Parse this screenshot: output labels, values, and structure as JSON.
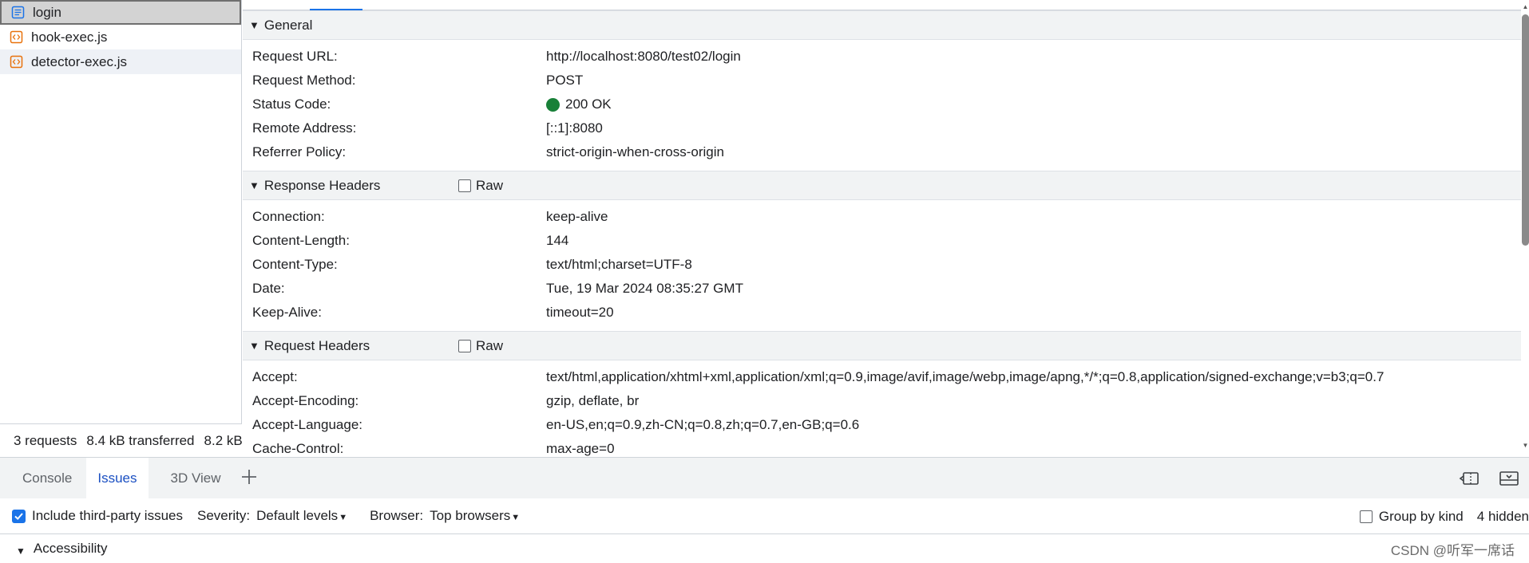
{
  "requests": [
    {
      "name": "login",
      "type": "document",
      "selected": true
    },
    {
      "name": "hook-exec.js",
      "type": "script",
      "selected": false
    },
    {
      "name": "detector-exec.js",
      "type": "script",
      "selected": false
    }
  ],
  "status_bar": {
    "requests": "3 requests",
    "transferred": "8.4 kB transferred",
    "resources": "8.2 kB"
  },
  "sections": {
    "general": {
      "title": "General",
      "rows": [
        {
          "key": "Request URL:",
          "value": "http://localhost:8080/test02/login"
        },
        {
          "key": "Request Method:",
          "value": "POST"
        },
        {
          "key": "Status Code:",
          "value": "200 OK"
        },
        {
          "key": "Remote Address:",
          "value": "[::1]:8080"
        },
        {
          "key": "Referrer Policy:",
          "value": "strict-origin-when-cross-origin"
        }
      ]
    },
    "response": {
      "title": "Response Headers",
      "raw_label": "Raw",
      "rows": [
        {
          "key": "Connection:",
          "value": "keep-alive"
        },
        {
          "key": "Content-Length:",
          "value": "144"
        },
        {
          "key": "Content-Type:",
          "value": "text/html;charset=UTF-8"
        },
        {
          "key": "Date:",
          "value": "Tue, 19 Mar 2024 08:35:27 GMT"
        },
        {
          "key": "Keep-Alive:",
          "value": "timeout=20"
        }
      ]
    },
    "request": {
      "title": "Request Headers",
      "raw_label": "Raw",
      "rows": [
        {
          "key": "Accept:",
          "value": "text/html,application/xhtml+xml,application/xml;q=0.9,image/avif,image/webp,image/apng,*/*;q=0.8,application/signed-exchange;v=b3;q=0.7"
        },
        {
          "key": "Accept-Encoding:",
          "value": "gzip, deflate, br"
        },
        {
          "key": "Accept-Language:",
          "value": "en-US,en;q=0.9,zh-CN;q=0.8,zh;q=0.7,en-GB;q=0.6"
        },
        {
          "key": "Cache-Control:",
          "value": "max-age=0"
        }
      ]
    }
  },
  "drawer": {
    "tabs": [
      "Console",
      "Issues",
      "3D View"
    ],
    "active_tab": "Issues"
  },
  "issues_toolbar": {
    "include_third_party": "Include third-party issues",
    "severity_label": "Severity:",
    "severity_value": "Default levels",
    "browser_label": "Browser:",
    "browser_value": "Top browsers",
    "group_by_kind": "Group by kind",
    "hidden_count": "4 hidden"
  },
  "accessibility": {
    "title": "Accessibility"
  },
  "watermark": "CSDN @听军一席话",
  "colors": {
    "status_ok": "#188038",
    "accent": "#1a73e8",
    "active_tab_text": "#1a4fc2"
  }
}
